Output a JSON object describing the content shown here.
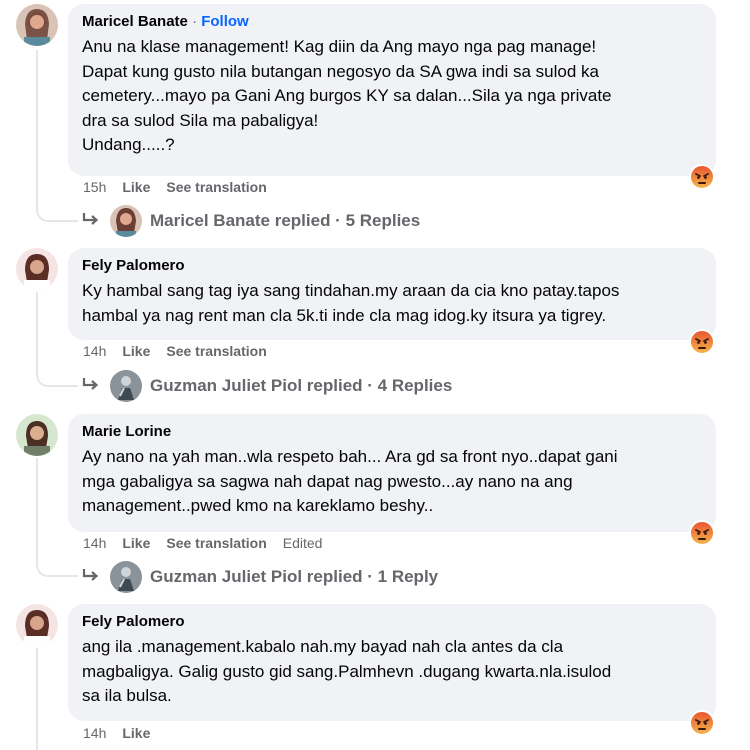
{
  "comments": [
    {
      "author": "Maricel Banate",
      "follow_label": "Follow",
      "separator": "·",
      "text": "Anu na klase management! Kag diin da Ang mayo nga pag manage!\nDapat kung gusto nila butangan negosyo da SA gwa indi sa sulod ka\ncemetery...mayo pa Gani Ang burgos KY sa dalan...Sila ya nga private\ndra sa sulod Sila ma pabaligya!\nUndang.....?",
      "time": "15h",
      "like_label": "Like",
      "translate_label": "See translation",
      "edited_label": "",
      "reaction_icon": "angry-reaction-icon",
      "replies_text": "Maricel Banate replied · 5 Replies"
    },
    {
      "author": "Fely Palomero",
      "follow_label": "",
      "separator": "",
      "text": "Ky hambal sang tag iya sang tindahan.my araan da cia kno patay.tapos\nhambal ya nag rent man cla 5k.ti inde cla mag idog.ky itsura ya tigrey.",
      "time": "14h",
      "like_label": "Like",
      "translate_label": "See translation",
      "edited_label": "",
      "reaction_icon": "angry-reaction-icon",
      "replies_text": "Guzman Juliet Piol replied · 4 Replies"
    },
    {
      "author": "Marie Lorine",
      "follow_label": "",
      "separator": "",
      "text": "Ay nano na yah man..wla respeto bah... Ara gd sa front nyo..dapat gani\nmga gabaligya sa sagwa nah dapat nag pwesto...ay nano na ang\nmanagement..pwed kmo na kareklamo beshy..",
      "time": "14h",
      "like_label": "Like",
      "translate_label": "See translation",
      "edited_label": "Edited",
      "reaction_icon": "angry-reaction-icon",
      "replies_text": "Guzman Juliet Piol replied · 1 Reply"
    },
    {
      "author": "Fely Palomero",
      "follow_label": "",
      "separator": "",
      "text": "ang ila .management.kabalo nah.my bayad nah cla antes da cla\nmagbaligya. Galig gusto gid sang.Palmhevn .dugang kwarta.nla.isulod\nsa ila bulsa.",
      "time": "14h",
      "like_label": "Like",
      "translate_label": "",
      "edited_label": "",
      "reaction_icon": "angry-reaction-icon",
      "replies_text": ""
    }
  ],
  "colors": {
    "bubble": "#f0f2f5",
    "follow": "#0866ff",
    "secondary_text": "#65676b",
    "angry_top": "#f5b94d",
    "angry_bottom": "#e9512f"
  }
}
